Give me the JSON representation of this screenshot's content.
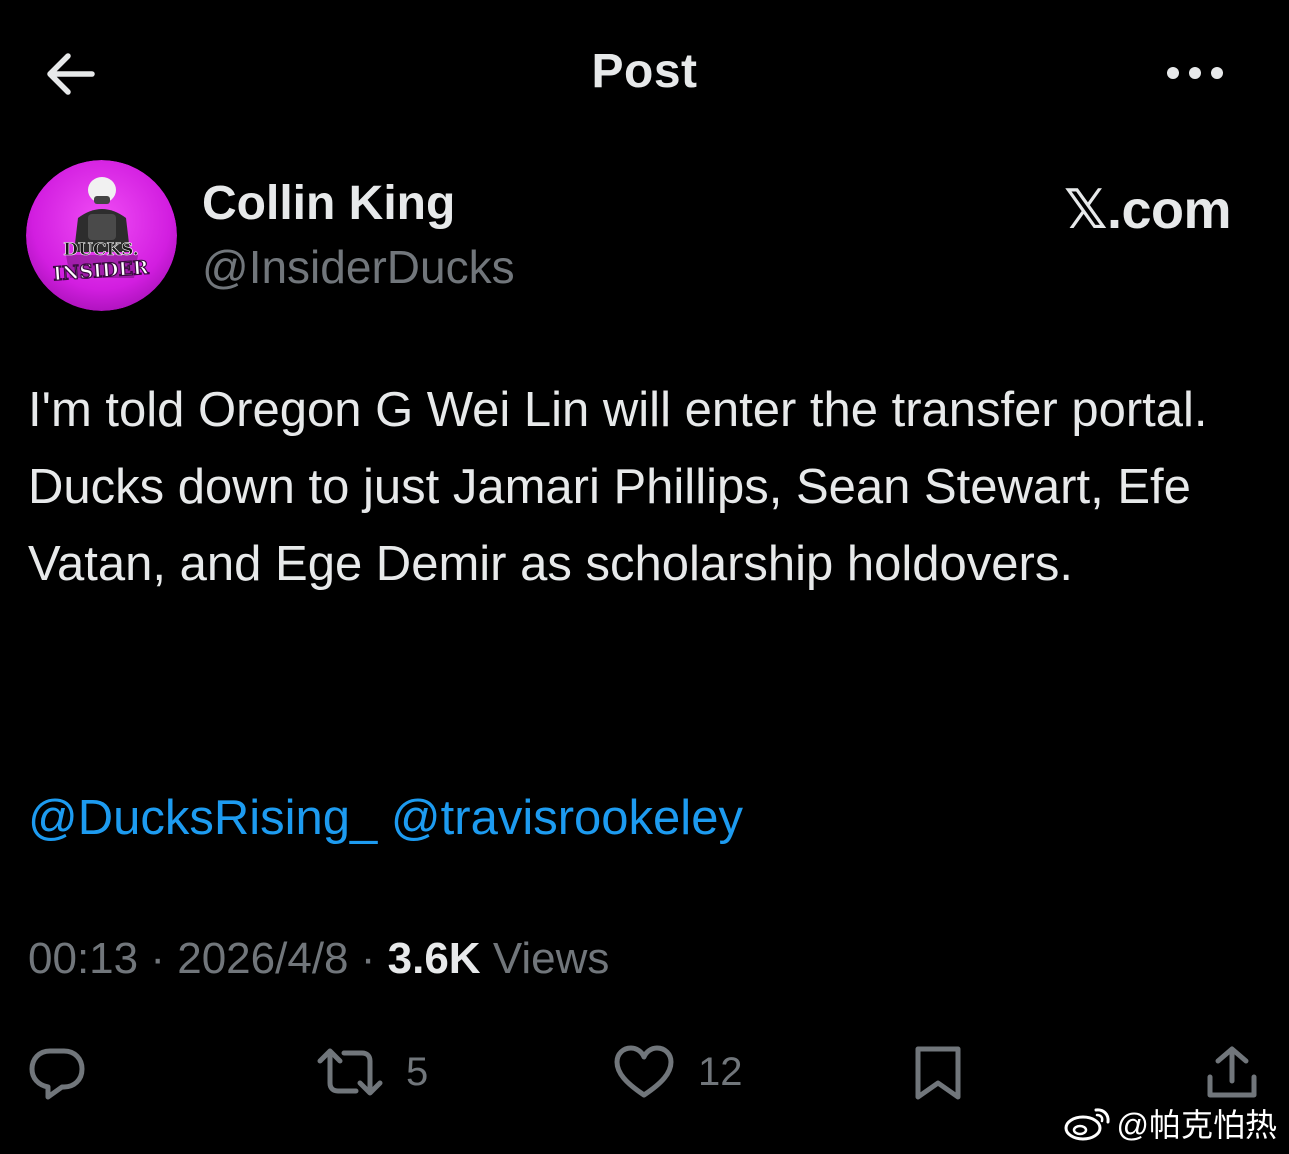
{
  "header": {
    "title": "Post",
    "back_icon": "arrow-left-icon",
    "more_icon": "more-horizontal-icon"
  },
  "author": {
    "name": "Collin King",
    "handle": "@InsiderDucks",
    "avatar_line1": "DUCKS.",
    "avatar_line2": "INSIDER",
    "avatar_color": "#d21ee0"
  },
  "source": "𝕏.com",
  "post": {
    "text": "I'm told Oregon G Wei Lin will enter the transfer portal. Ducks down to just Jamari Phillips, Sean Stewart, Efe Vatan, and Ege Demir as scholarship holdovers.",
    "mentions": [
      "@DucksRising_",
      "@travisrookeley"
    ]
  },
  "meta": {
    "time": "00:13",
    "date": "2026/4/8",
    "views_count": "3.6K",
    "views_label": "Views",
    "separator": "·"
  },
  "actions": {
    "reply_icon": "reply-icon",
    "repost_icon": "repost-icon",
    "repost_count": "5",
    "like_icon": "heart-icon",
    "like_count": "12",
    "bookmark_icon": "bookmark-icon",
    "share_icon": "share-icon"
  },
  "watermark": {
    "text": "@帕克怕热",
    "icon": "weibo-icon"
  },
  "colors": {
    "background": "#000000",
    "text_primary": "#e7e9ea",
    "text_secondary": "#71767b",
    "link": "#1d9bf0"
  }
}
